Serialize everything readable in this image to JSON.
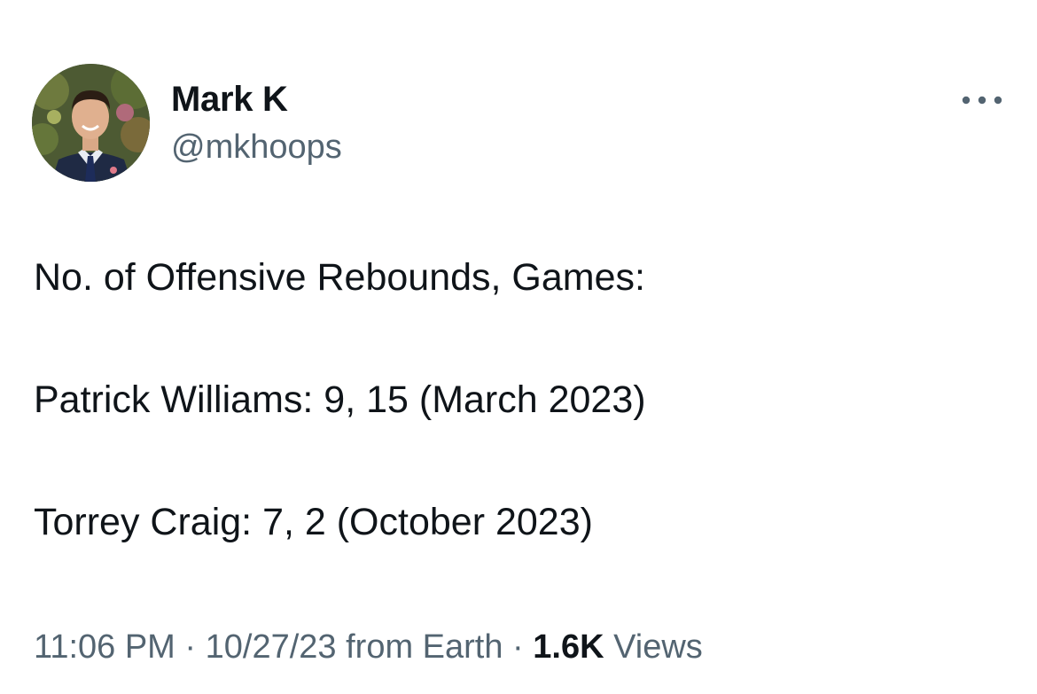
{
  "author": {
    "display_name": "Mark K",
    "handle": "@mkhoops",
    "avatar_icon": "profile-photo"
  },
  "more_icon": "more-horizontal-icon",
  "tweet": {
    "lines": [
      "No. of Offensive Rebounds, Games:",
      "Patrick Williams: 9, 15 (March 2023)",
      "Torrey Craig: 7, 2 (October 2023)"
    ]
  },
  "meta": {
    "time": "11:06 PM",
    "separator": " · ",
    "date": "10/27/23",
    "source": "from Earth",
    "views_count": "1.6K",
    "views_label": "Views"
  },
  "colors": {
    "text_primary": "#0f1419",
    "text_secondary": "#536471",
    "background": "#ffffff"
  }
}
